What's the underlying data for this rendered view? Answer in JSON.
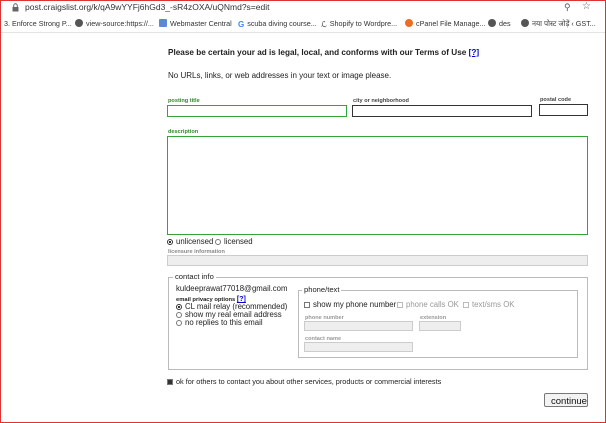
{
  "browser": {
    "url": "post.craigslist.org/k/qA9wYYFj6hGd3_-sR4zOXA/uQNmd?s=edit",
    "bookmarks": [
      {
        "label": "3. Enforce Strong P...",
        "icon": "enforce-icon"
      },
      {
        "label": "view-source:https://...",
        "icon": "globe-icon"
      },
      {
        "label": "Webmaster Central",
        "icon": "webmaster-icon"
      },
      {
        "label": "scuba diving course...",
        "icon": "google-icon"
      },
      {
        "label": "Shopify to Wordpre...",
        "icon": "zap-icon"
      },
      {
        "label": "cPanel File Manage...",
        "icon": "cpanel-icon"
      },
      {
        "label": "des",
        "icon": "globe-icon"
      },
      {
        "label": "नया पोस्ट जोड़ें ‹ GST...",
        "icon": "wordpress-icon"
      }
    ]
  },
  "form": {
    "notice": "Please be certain your ad is legal, local, and conforms with our Terms of Use",
    "notice_link": "[?]",
    "no_urls_note": "No URLs, links, or web addresses in your text or image please.",
    "posting_title_label": "posting title",
    "posting_title_value": "",
    "city_label": "city or neighborhood",
    "city_value": "",
    "postal_label": "postal code",
    "postal_value": "",
    "description_label": "description",
    "description_value": "",
    "license_options": [
      "unlicensed",
      "licensed"
    ],
    "license_selected": "unlicensed",
    "licensure_label": "licensure information",
    "contact_legend": "contact info",
    "email": "kuldeeprawat77018@gmail.com",
    "email_privacy_label": "email privacy options",
    "email_privacy_help": "[?]",
    "privacy_options": [
      "CL mail relay (recommended)",
      "show my real email address",
      "no replies to this email"
    ],
    "privacy_selected": "CL mail relay (recommended)",
    "phone_legend": "phone/text",
    "show_phone_label": "show my phone number",
    "phone_calls_label": "phone calls OK",
    "text_sms_label": "text/sms OK",
    "phone_number_label": "phone number",
    "extension_label": "extension",
    "contact_name_label": "contact name",
    "ok_contact_label": "ok for others to contact you about other services, products or commercial interests",
    "continue_label": "continue"
  },
  "colors": {
    "accent_green": "#36a336",
    "frame_red": "#dd3333",
    "link_blue": "#0000cc"
  }
}
